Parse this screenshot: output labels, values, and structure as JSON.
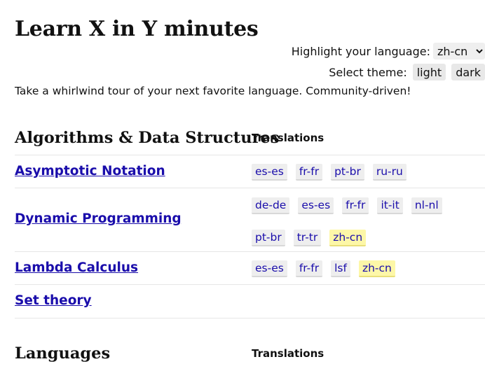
{
  "site": {
    "title": "Learn X in Y minutes",
    "tagline": "Take a whirlwind tour of your next favorite language. Community-driven!"
  },
  "controls": {
    "highlight_label": "Highlight your language:",
    "highlight_value": "zh-cn",
    "theme_label": "Select theme:",
    "theme_light": "light",
    "theme_dark": "dark"
  },
  "sections": [
    {
      "heading": "Algorithms & Data Structures",
      "translations_label": "Translations",
      "rows": [
        {
          "topic": "Asymptotic Notation",
          "tags": [
            "es-es",
            "fr-fr",
            "pt-br",
            "ru-ru"
          ]
        },
        {
          "topic": "Dynamic Programming",
          "tags": [
            "de-de",
            "es-es",
            "fr-fr",
            "it-it",
            "nl-nl",
            "pt-br",
            "tr-tr",
            "zh-cn"
          ]
        },
        {
          "topic": "Lambda Calculus",
          "tags": [
            "es-es",
            "fr-fr",
            "lsf",
            "zh-cn"
          ]
        },
        {
          "topic": "Set theory",
          "tags": []
        }
      ]
    },
    {
      "heading": "Languages",
      "translations_label": "Translations",
      "rows": []
    }
  ],
  "colors": {
    "link": "#1a0dab",
    "highlight_tag_bg": "#fdf7a8",
    "tag_bg": "#eeeeee"
  }
}
